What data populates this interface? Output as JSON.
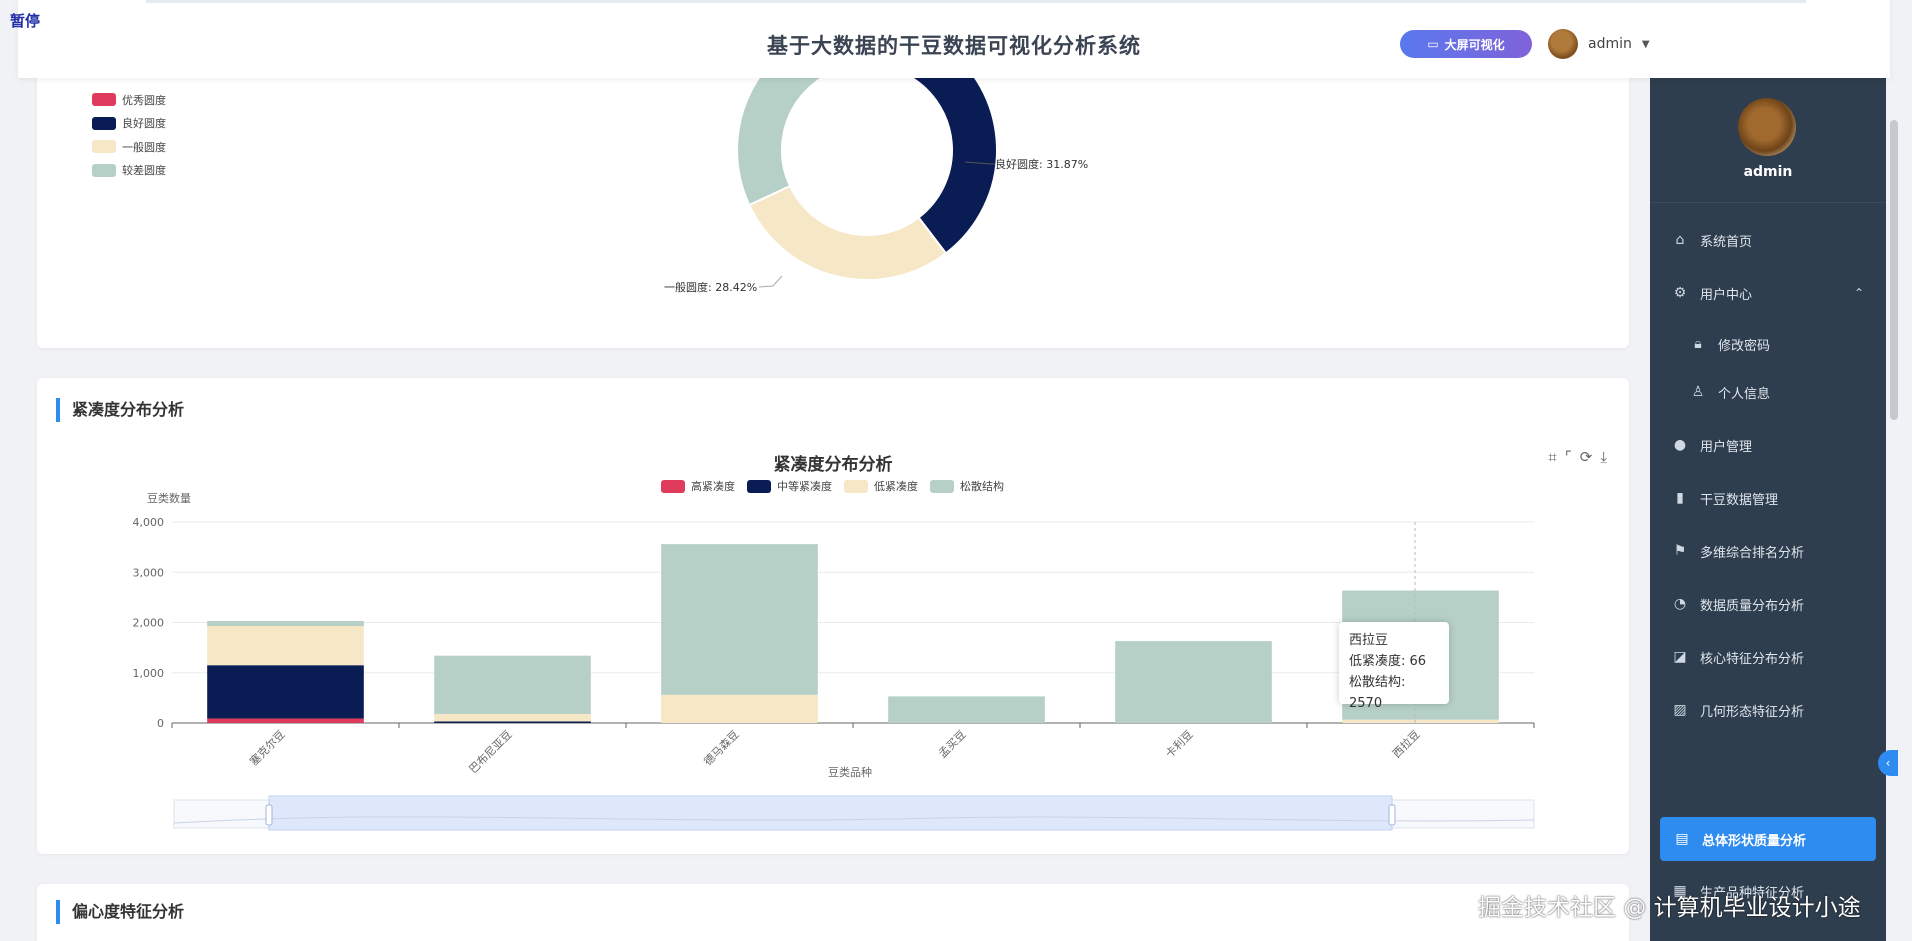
{
  "overlay": {
    "pause_label": "暂停"
  },
  "header": {
    "title": "基于大数据的干豆数据可视化分析系统",
    "bigscreen_label": "大屏可视化",
    "username": "admin"
  },
  "sidebar": {
    "username": "admin",
    "items": [
      {
        "label": "系统首页",
        "icon": "home-icon"
      },
      {
        "label": "用户中心",
        "icon": "gear-icon",
        "expanded": true
      },
      {
        "label": "修改密码",
        "icon": "lock-icon"
      },
      {
        "label": "个人信息",
        "icon": "user-icon"
      },
      {
        "label": "用户管理",
        "icon": "person-icon"
      },
      {
        "label": "干豆数据管理",
        "icon": "bar-chart-icon"
      },
      {
        "label": "多维综合排名分析",
        "icon": "flag-icon"
      },
      {
        "label": "数据质量分布分析",
        "icon": "pie-icon"
      },
      {
        "label": "核心特征分布分析",
        "icon": "line-chart-icon"
      },
      {
        "label": "几何形态特征分析",
        "icon": "image-icon"
      },
      {
        "label": "总体形状质量分析",
        "icon": "clipboard-icon",
        "active": true
      },
      {
        "label": "生产品种特征分析",
        "icon": "grid-icon"
      }
    ]
  },
  "roundness_card": {
    "legend": [
      "优秀圆度",
      "良好圆度",
      "一般圆度",
      "较差圆度"
    ],
    "label_good": "良好圆度: 31.87%",
    "label_general": "一般圆度: 28.42%"
  },
  "compactness_card": {
    "section_title": "紧凑度分布分析",
    "tooltip": {
      "title": "西拉豆",
      "line1": "低紧凑度: 66",
      "line2": "松散结构: 2570"
    }
  },
  "eccentricity_card": {
    "section_title": "偏心度特征分析"
  },
  "watermark": "掘金技术社区 @ 计算机毕业设计小途",
  "colors": {
    "red": "#e03a5c",
    "navy": "#0a1c54",
    "cream": "#f6e7c6",
    "sage": "#b6d0c8",
    "accent": "#2e8bf0"
  },
  "chart_data": [
    {
      "type": "pie",
      "title": "",
      "series": [
        {
          "name": "优秀圆度",
          "value": 1.7
        },
        {
          "name": "良好圆度",
          "value": 31.87
        },
        {
          "name": "一般圆度",
          "value": 28.42
        },
        {
          "name": "较差圆度",
          "value": 38.01
        }
      ]
    },
    {
      "type": "bar",
      "stacked": true,
      "title": "紧凑度分布分析",
      "xlabel": "豆类品种",
      "ylabel": "豆类数量",
      "ylim": [
        0,
        4000
      ],
      "yticks": [
        "0",
        "1,000",
        "2,000",
        "3,000",
        "4,000"
      ],
      "categories": [
        "塞克尔豆",
        "巴布尼亚豆",
        "德马森豆",
        "孟买豆",
        "卡利豆",
        "西拉豆"
      ],
      "series": [
        {
          "name": "高紧凑度",
          "values": [
            90,
            0,
            0,
            0,
            0,
            0
          ]
        },
        {
          "name": "中等紧凑度",
          "values": [
            1060,
            30,
            0,
            0,
            0,
            0
          ]
        },
        {
          "name": "低紧凑度",
          "values": [
            780,
            150,
            560,
            0,
            0,
            66
          ]
        },
        {
          "name": "松散结构",
          "values": [
            100,
            1160,
            3000,
            530,
            1630,
            2570
          ]
        }
      ]
    }
  ]
}
